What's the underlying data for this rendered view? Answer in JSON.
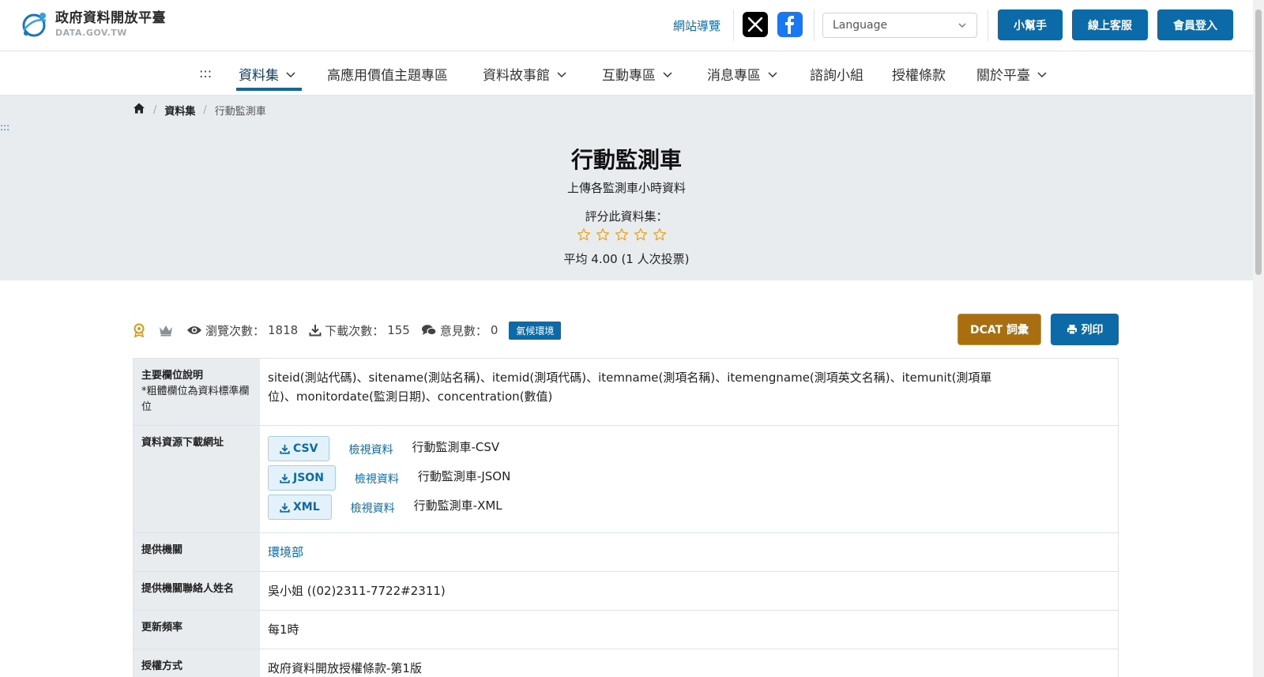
{
  "header": {
    "logo_cn": "政府資料開放平臺",
    "logo_en": "DATA.GOV.TW",
    "sitemap": "網站導覽",
    "language_placeholder": "Language",
    "helper_btn": "小幫手",
    "service_btn": "線上客服",
    "login_btn": "會員登入",
    "colors": {
      "primary": "#0d6aa8",
      "dcat": "#a86e10",
      "hero_bg": "#e9ecef"
    }
  },
  "nav": {
    "accesskey": ":::",
    "items": [
      "資料集",
      "高應用價值主題專區",
      "資料故事館",
      "互動專區",
      "消息專區",
      "諮詢小組",
      "授權條款",
      "關於平臺"
    ]
  },
  "breadcrumb": {
    "home_icon": "home-icon",
    "level1": "資料集",
    "current": "行動監測車"
  },
  "hero": {
    "accesskey": ":::",
    "title": "行動監測車",
    "description": "上傳各監測車小時資料",
    "rate_label": "評分此資料集：",
    "stars_filled": 0,
    "stars_total": 5,
    "average": "平均 4.00 (1 人次投票)"
  },
  "stats": {
    "views_label": "瀏覽次數：",
    "views": "1818",
    "downloads_label": "下載次數：",
    "downloads": "155",
    "comments_label": "意見數：",
    "comments": "0",
    "tag": "氣候環境",
    "dcat_btn": "DCAT 詞彙",
    "print_btn": "列印"
  },
  "table": {
    "fields_label": "主要欄位說明",
    "fields_note": "*粗體欄位為資料標準欄位",
    "fields_value": "siteid(測站代碼)、sitename(測站名稱)、itemid(測項代碼)、itemname(測項名稱)、itemengname(測項英文名稱)、itemunit(測項單位)、monitordate(監測日期)、concentration(數值)",
    "resources_label": "資料資源下載網址",
    "resources": [
      {
        "format": "CSV",
        "view": "檢視資料",
        "name": "行動監測車-CSV"
      },
      {
        "format": "JSON",
        "view": "檢視資料",
        "name": "行動監測車-JSON"
      },
      {
        "format": "XML",
        "view": "檢視資料",
        "name": "行動監測車-XML"
      }
    ],
    "agency_label": "提供機關",
    "agency_value": "環境部",
    "contact_label": "提供機關聯絡人姓名",
    "contact_value": "吳小姐 ((02)2311-7722#2311)",
    "frequency_label": "更新頻率",
    "frequency_value": "每1時",
    "license_label": "授權方式",
    "license_value": "政府資料開放授權條款-第1版"
  }
}
